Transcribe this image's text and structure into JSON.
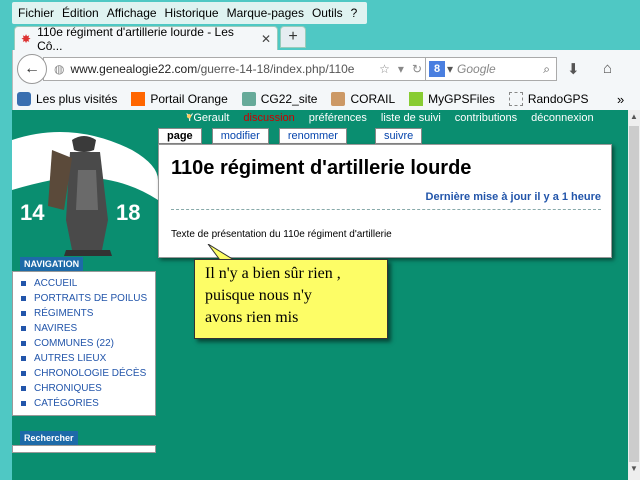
{
  "menubar": {
    "items": [
      "Fichier",
      "Édition",
      "Affichage",
      "Historique",
      "Marque-pages",
      "Outils",
      "?"
    ]
  },
  "tab": {
    "title": "110e régiment d'artillerie lourde - Les Cô...",
    "close": "✕",
    "new_tab": "+"
  },
  "navbar": {
    "url_host": "www.genealogie22.com",
    "url_path": "/guerre-14-18/index.php/110e",
    "search_placeholder": "Google",
    "search_engine_letter": "8"
  },
  "bookmarks": {
    "items": [
      "Les plus visités",
      "Portail Orange",
      "CG22_site",
      "CORAIL",
      "MyGPSFiles",
      "RandoGPS"
    ],
    "overflow": "»"
  },
  "logo": {
    "left_number": "14",
    "right_number": "18"
  },
  "userbar": {
    "items": [
      "YGerault",
      "discussion",
      "préférences",
      "liste de suivi",
      "contributions",
      "déconnexion"
    ]
  },
  "page_tabs": [
    "page",
    "modifier",
    "renommer",
    "suivre"
  ],
  "content": {
    "title": "110e régiment d'artillerie lourde",
    "last_update": "Dernière mise à jour il y a 1 heure",
    "body": "Texte de présentation du 110e régiment d'artillerie"
  },
  "sidebar": {
    "nav_title": "NAVIGATION",
    "nav_items": [
      "ACCUEIL",
      "PORTRAITS DE POILUS",
      "RÉGIMENTS",
      "NAVIRES",
      "COMMUNES (22)",
      "AUTRES LIEUX",
      "CHRONOLOGIE DÉCÈS",
      "CHRONIQUES",
      "CATÉGORIES"
    ],
    "search_title": "Rechercher"
  },
  "callout": {
    "line1": "Il n'y a bien sûr rien ,",
    "line2": "puisque nous n'y",
    "line3": "avons rien mis"
  },
  "colors": {
    "viewport_bg": "#0a8e70",
    "accent_blue": "#1d6aa8",
    "callout_bg": "#fdfd66"
  }
}
